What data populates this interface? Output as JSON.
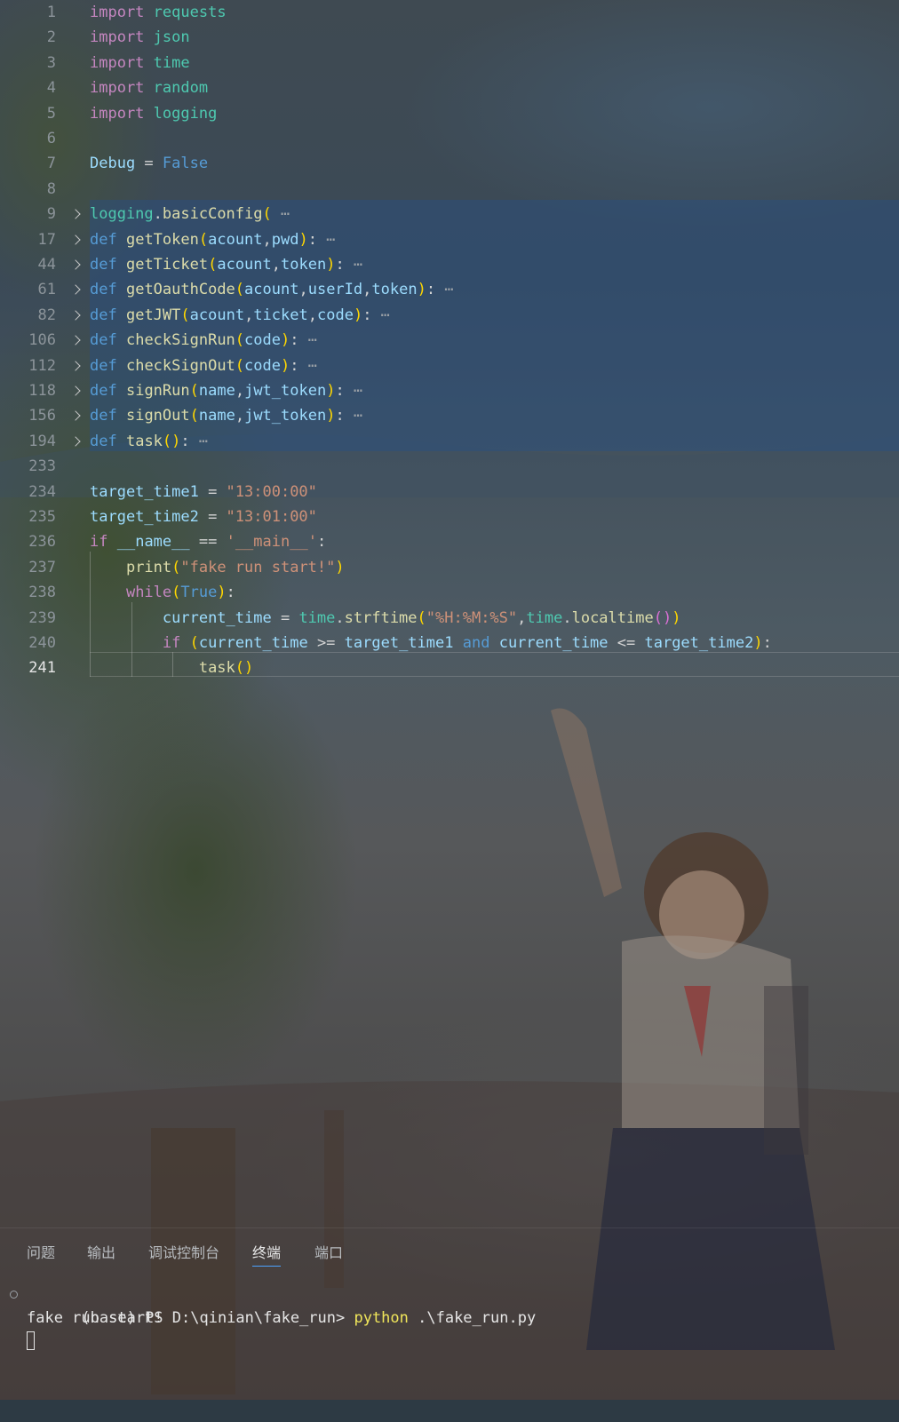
{
  "editor": {
    "lines": [
      {
        "n": "1",
        "tokens": [
          [
            "kw",
            "import"
          ],
          [
            "op",
            " "
          ],
          [
            "mod",
            "requests"
          ]
        ]
      },
      {
        "n": "2",
        "tokens": [
          [
            "kw",
            "import"
          ],
          [
            "op",
            " "
          ],
          [
            "mod",
            "json"
          ]
        ]
      },
      {
        "n": "3",
        "tokens": [
          [
            "kw",
            "import"
          ],
          [
            "op",
            " "
          ],
          [
            "mod",
            "time"
          ]
        ]
      },
      {
        "n": "4",
        "tokens": [
          [
            "kw",
            "import"
          ],
          [
            "op",
            " "
          ],
          [
            "mod",
            "random"
          ]
        ]
      },
      {
        "n": "5",
        "tokens": [
          [
            "kw",
            "import"
          ],
          [
            "op",
            " "
          ],
          [
            "mod",
            "logging"
          ]
        ]
      },
      {
        "n": "6",
        "tokens": []
      },
      {
        "n": "7",
        "tokens": [
          [
            "var",
            "Debug"
          ],
          [
            "op",
            " = "
          ],
          [
            "kw2",
            "False"
          ]
        ]
      },
      {
        "n": "8",
        "tokens": []
      },
      {
        "n": "9",
        "fold": true,
        "tokens": [
          [
            "mod",
            "logging"
          ],
          [
            "op",
            "."
          ],
          [
            "fn",
            "basicConfig"
          ],
          [
            "br1",
            "("
          ],
          [
            "dots",
            " ⋯"
          ]
        ]
      },
      {
        "n": "17",
        "fold": true,
        "tokens": [
          [
            "kw2",
            "def"
          ],
          [
            "op",
            " "
          ],
          [
            "fn",
            "getToken"
          ],
          [
            "br1",
            "("
          ],
          [
            "var",
            "acount"
          ],
          [
            "op",
            ","
          ],
          [
            "var",
            "pwd"
          ],
          [
            "br1",
            ")"
          ],
          [
            "op",
            ":"
          ],
          [
            "dots",
            " ⋯"
          ]
        ]
      },
      {
        "n": "44",
        "fold": true,
        "tokens": [
          [
            "kw2",
            "def"
          ],
          [
            "op",
            " "
          ],
          [
            "fn",
            "getTicket"
          ],
          [
            "br1",
            "("
          ],
          [
            "var",
            "acount"
          ],
          [
            "op",
            ","
          ],
          [
            "var",
            "token"
          ],
          [
            "br1",
            ")"
          ],
          [
            "op",
            ":"
          ],
          [
            "dots",
            " ⋯"
          ]
        ]
      },
      {
        "n": "61",
        "fold": true,
        "tokens": [
          [
            "kw2",
            "def"
          ],
          [
            "op",
            " "
          ],
          [
            "fn",
            "getOauthCode"
          ],
          [
            "br1",
            "("
          ],
          [
            "var",
            "acount"
          ],
          [
            "op",
            ","
          ],
          [
            "var",
            "userId"
          ],
          [
            "op",
            ","
          ],
          [
            "var",
            "token"
          ],
          [
            "br1",
            ")"
          ],
          [
            "op",
            ":"
          ],
          [
            "dots",
            " ⋯"
          ]
        ]
      },
      {
        "n": "82",
        "fold": true,
        "tokens": [
          [
            "kw2",
            "def"
          ],
          [
            "op",
            " "
          ],
          [
            "fn",
            "getJWT"
          ],
          [
            "br1",
            "("
          ],
          [
            "var",
            "acount"
          ],
          [
            "op",
            ","
          ],
          [
            "var",
            "ticket"
          ],
          [
            "op",
            ","
          ],
          [
            "var",
            "code"
          ],
          [
            "br1",
            ")"
          ],
          [
            "op",
            ":"
          ],
          [
            "dots",
            " ⋯"
          ]
        ]
      },
      {
        "n": "106",
        "fold": true,
        "tokens": [
          [
            "kw2",
            "def"
          ],
          [
            "op",
            " "
          ],
          [
            "fn",
            "checkSignRun"
          ],
          [
            "br1",
            "("
          ],
          [
            "var",
            "code"
          ],
          [
            "br1",
            ")"
          ],
          [
            "op",
            ":"
          ],
          [
            "dots",
            " ⋯"
          ]
        ]
      },
      {
        "n": "112",
        "fold": true,
        "tokens": [
          [
            "kw2",
            "def"
          ],
          [
            "op",
            " "
          ],
          [
            "fn",
            "checkSignOut"
          ],
          [
            "br1",
            "("
          ],
          [
            "var",
            "code"
          ],
          [
            "br1",
            ")"
          ],
          [
            "op",
            ":"
          ],
          [
            "dots",
            " ⋯"
          ]
        ]
      },
      {
        "n": "118",
        "fold": true,
        "tokens": [
          [
            "kw2",
            "def"
          ],
          [
            "op",
            " "
          ],
          [
            "fn",
            "signRun"
          ],
          [
            "br1",
            "("
          ],
          [
            "var",
            "name"
          ],
          [
            "op",
            ","
          ],
          [
            "var",
            "jwt_token"
          ],
          [
            "br1",
            ")"
          ],
          [
            "op",
            ":"
          ],
          [
            "dots",
            " ⋯"
          ]
        ]
      },
      {
        "n": "156",
        "fold": true,
        "tokens": [
          [
            "kw2",
            "def"
          ],
          [
            "op",
            " "
          ],
          [
            "fn",
            "signOut"
          ],
          [
            "br1",
            "("
          ],
          [
            "var",
            "name"
          ],
          [
            "op",
            ","
          ],
          [
            "var",
            "jwt_token"
          ],
          [
            "br1",
            ")"
          ],
          [
            "op",
            ":"
          ],
          [
            "dots",
            " ⋯"
          ]
        ]
      },
      {
        "n": "194",
        "fold": true,
        "tokens": [
          [
            "kw2",
            "def"
          ],
          [
            "op",
            " "
          ],
          [
            "fn",
            "task"
          ],
          [
            "br1",
            "()"
          ],
          [
            "op",
            ":"
          ],
          [
            "dots",
            " ⋯"
          ]
        ]
      },
      {
        "n": "233",
        "tokens": []
      },
      {
        "n": "234",
        "tokens": [
          [
            "var",
            "target_time1"
          ],
          [
            "op",
            " = "
          ],
          [
            "str",
            "\"13:00:00\""
          ]
        ]
      },
      {
        "n": "235",
        "tokens": [
          [
            "var",
            "target_time2"
          ],
          [
            "op",
            " = "
          ],
          [
            "str",
            "\"13:01:00\""
          ]
        ]
      },
      {
        "n": "236",
        "tokens": [
          [
            "kw",
            "if"
          ],
          [
            "op",
            " "
          ],
          [
            "var",
            "__name__"
          ],
          [
            "op",
            " == "
          ],
          [
            "str",
            "'__main__'"
          ],
          [
            "op",
            ":"
          ]
        ]
      },
      {
        "n": "237",
        "tokens": [
          [
            "op",
            "    "
          ],
          [
            "fn",
            "print"
          ],
          [
            "br1",
            "("
          ],
          [
            "str",
            "\"fake run start!\""
          ],
          [
            "br1",
            ")"
          ]
        ]
      },
      {
        "n": "238",
        "tokens": [
          [
            "op",
            "    "
          ],
          [
            "kw",
            "while"
          ],
          [
            "br1",
            "("
          ],
          [
            "kw2",
            "True"
          ],
          [
            "br1",
            ")"
          ],
          [
            "op",
            ":"
          ]
        ]
      },
      {
        "n": "239",
        "tokens": [
          [
            "op",
            "        "
          ],
          [
            "var",
            "current_time"
          ],
          [
            "op",
            " = "
          ],
          [
            "mod",
            "time"
          ],
          [
            "op",
            "."
          ],
          [
            "fn",
            "strftime"
          ],
          [
            "br1",
            "("
          ],
          [
            "str",
            "\"%H:%M:%S\""
          ],
          [
            "op",
            ","
          ],
          [
            "mod",
            "time"
          ],
          [
            "op",
            "."
          ],
          [
            "fn",
            "localtime"
          ],
          [
            "br2",
            "()"
          ],
          [
            "br1",
            ")"
          ]
        ]
      },
      {
        "n": "240",
        "tokens": [
          [
            "op",
            "        "
          ],
          [
            "kw",
            "if"
          ],
          [
            "op",
            " "
          ],
          [
            "br1",
            "("
          ],
          [
            "var",
            "current_time"
          ],
          [
            "op",
            " >= "
          ],
          [
            "var",
            "target_time1"
          ],
          [
            "op",
            " "
          ],
          [
            "kw2",
            "and"
          ],
          [
            "op",
            " "
          ],
          [
            "var",
            "current_time"
          ],
          [
            "op",
            " <= "
          ],
          [
            "var",
            "target_time2"
          ],
          [
            "br1",
            ")"
          ],
          [
            "op",
            ":"
          ]
        ]
      },
      {
        "n": "241",
        "active": true,
        "tokens": [
          [
            "op",
            "            "
          ],
          [
            "fn",
            "task"
          ],
          [
            "br1",
            "()"
          ]
        ]
      }
    ]
  },
  "panel": {
    "tabs": [
      "问题",
      "输出",
      "调试控制台",
      "终端",
      "端口"
    ],
    "active_tab": "终端"
  },
  "terminal": {
    "prompt": "(base) PS D:\\qinian\\fake_run> ",
    "command": "python",
    "args": " .\\fake_run.py",
    "output": "fake run start!"
  }
}
